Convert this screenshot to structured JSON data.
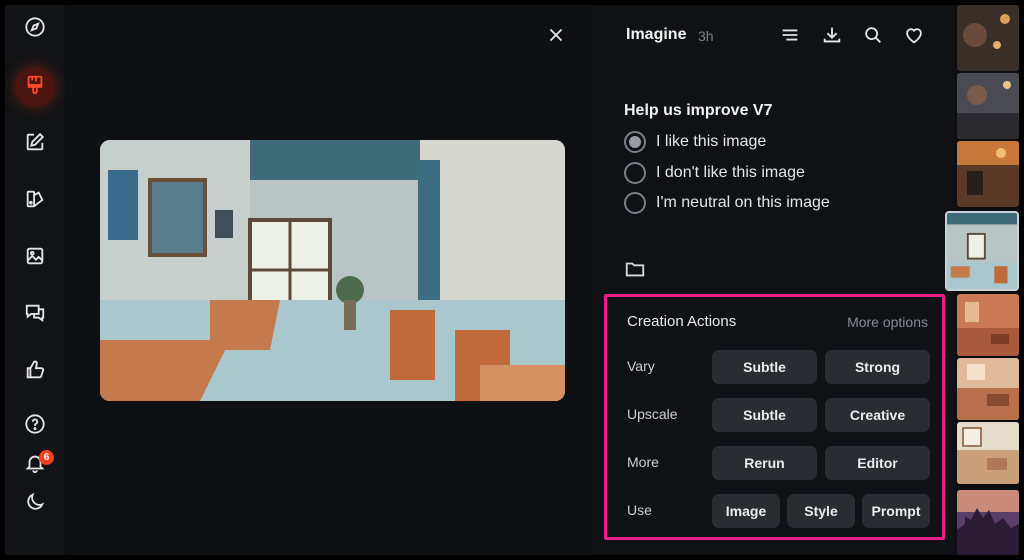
{
  "sidebar": {
    "items": [
      {
        "name": "explore",
        "icon": "compass-icon"
      },
      {
        "name": "create",
        "icon": "brush-icon",
        "active": true
      },
      {
        "name": "edit",
        "icon": "edit-icon"
      },
      {
        "name": "personalize",
        "icon": "palette-icon"
      },
      {
        "name": "organize",
        "icon": "image-icon"
      },
      {
        "name": "chat",
        "icon": "chat-icon"
      },
      {
        "name": "rank",
        "icon": "thumbs-up-icon"
      },
      {
        "name": "help",
        "icon": "question-icon"
      },
      {
        "name": "notifications",
        "icon": "bell-icon",
        "badge": "6"
      },
      {
        "name": "theme",
        "icon": "moon-icon"
      }
    ]
  },
  "viewer": {
    "close_icon": "close-icon"
  },
  "panel": {
    "title": "Imagine",
    "age": "3h",
    "header_icons": [
      "list-icon",
      "download-icon",
      "search-icon",
      "heart-icon"
    ],
    "feedback": {
      "title": "Help us improve V7",
      "options": [
        {
          "label": "I like this image",
          "selected": true
        },
        {
          "label": "I don't like this image",
          "selected": false
        },
        {
          "label": "I'm neutral on this image",
          "selected": false
        }
      ]
    },
    "folder_icon": "folder-icon",
    "actions": {
      "title": "Creation Actions",
      "more_options": "More options",
      "highlight_color": "#ec1e8a",
      "rows": [
        {
          "label": "Vary",
          "buttons": [
            "Subtle",
            "Strong"
          ]
        },
        {
          "label": "Upscale",
          "buttons": [
            "Subtle",
            "Creative"
          ]
        },
        {
          "label": "More",
          "buttons": [
            "Rerun",
            "Editor"
          ]
        },
        {
          "label": "Use",
          "buttons": [
            "Image",
            "Style",
            "Prompt"
          ]
        }
      ]
    }
  },
  "colors": {
    "accent": "#ff4a2a",
    "badge": "#f2401f",
    "chip": "#2a2c31"
  }
}
